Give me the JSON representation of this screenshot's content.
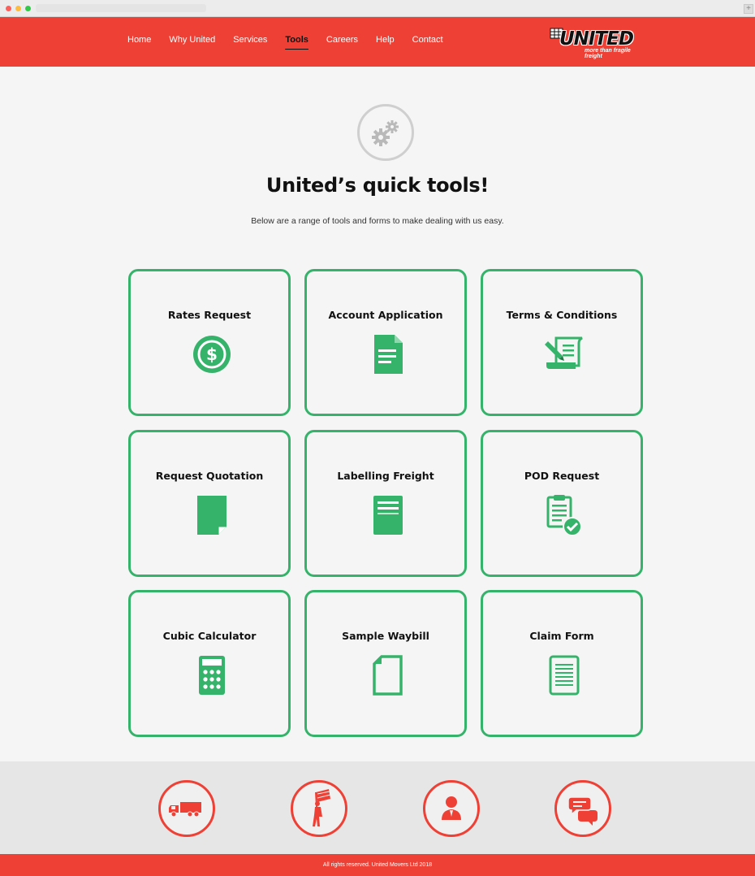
{
  "nav": {
    "items": [
      {
        "label": "Home"
      },
      {
        "label": "Why United"
      },
      {
        "label": "Services"
      },
      {
        "label": "Tools",
        "active": true
      },
      {
        "label": "Careers"
      },
      {
        "label": "Help"
      },
      {
        "label": "Contact"
      }
    ]
  },
  "logo": {
    "wordmark": "UNITED",
    "tagline": "more than fragile freight"
  },
  "hero": {
    "icon": "gears-icon",
    "title": "United’s quick tools!",
    "subtitle": "Below are a range of tools and forms to make dealing with us easy."
  },
  "tools": [
    {
      "label": "Rates Request",
      "icon": "dollar-coin-icon"
    },
    {
      "label": "Account Application",
      "icon": "document-icon"
    },
    {
      "label": "Terms & Conditions",
      "icon": "scroll-pen-icon"
    },
    {
      "label": "Request Quotation",
      "icon": "page-curl-icon"
    },
    {
      "label": "Labelling Freight",
      "icon": "label-sheet-icon"
    },
    {
      "label": "POD Request",
      "icon": "clipboard-check-icon"
    },
    {
      "label": "Cubic Calculator",
      "icon": "calculator-icon"
    },
    {
      "label": "Sample Waybill",
      "icon": "blank-page-icon"
    },
    {
      "label": "Claim Form",
      "icon": "lined-form-icon"
    }
  ],
  "footer": {
    "icons": [
      "truck-icon",
      "mover-flag-icon",
      "person-icon",
      "chat-bubbles-icon"
    ],
    "copyright": "All rights reserved. United Movers Ltd 2018"
  },
  "colors": {
    "brand_red": "#ef4036",
    "tool_green": "#36b36a"
  }
}
